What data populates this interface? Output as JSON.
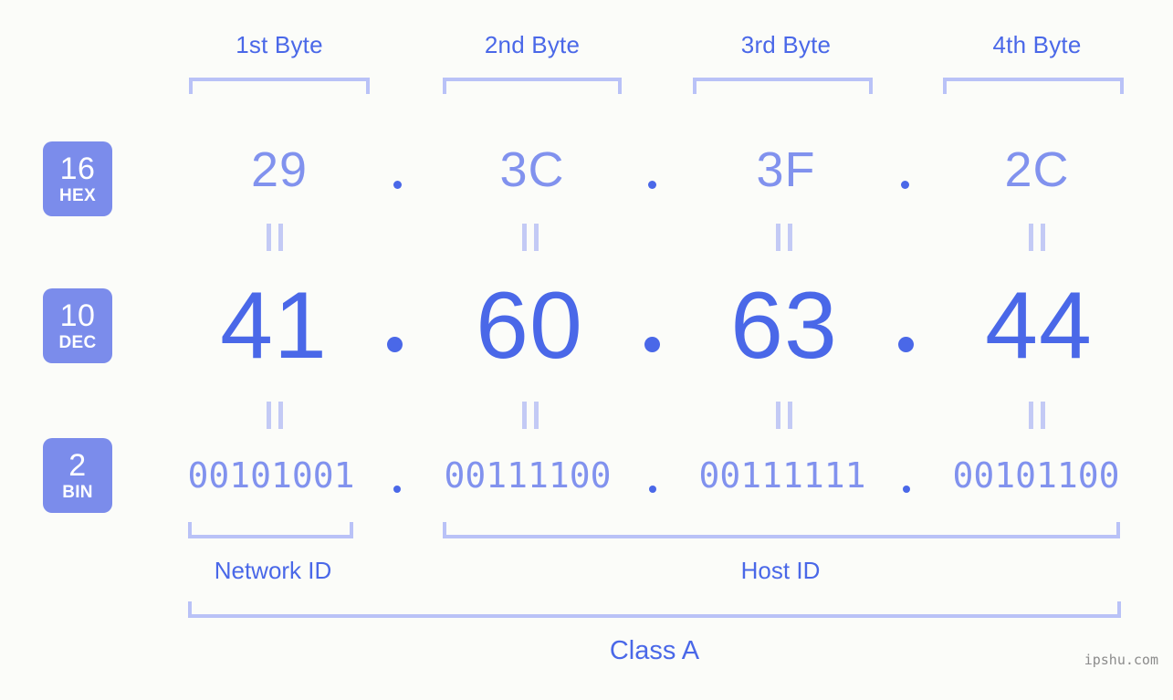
{
  "byte_headers": [
    {
      "label": "1st Byte"
    },
    {
      "label": "2nd Byte"
    },
    {
      "label": "3rd Byte"
    },
    {
      "label": "4th Byte"
    }
  ],
  "rows": {
    "hex": {
      "base": "16",
      "abbr": "HEX",
      "values": [
        "29",
        "3C",
        "3F",
        "2C"
      ]
    },
    "dec": {
      "base": "10",
      "abbr": "DEC",
      "values": [
        "41",
        "60",
        "63",
        "44"
      ]
    },
    "bin": {
      "base": "2",
      "abbr": "BIN",
      "values": [
        "00101001",
        "00111100",
        "00111111",
        "00101100"
      ]
    }
  },
  "separator": ".",
  "equals_mark": "||",
  "segments": {
    "network_id": "Network ID",
    "host_id": "Host ID"
  },
  "address_class": "Class A",
  "watermark": "ipshu.com",
  "colors": {
    "background": "#fbfcf9",
    "badge": "#7b8ceb",
    "accent_strong": "#4a68e8",
    "accent_light": "#8192ee",
    "bracket": "#b9c2f7",
    "equals": "#c3caf5",
    "watermark": "#8c8c8c"
  }
}
